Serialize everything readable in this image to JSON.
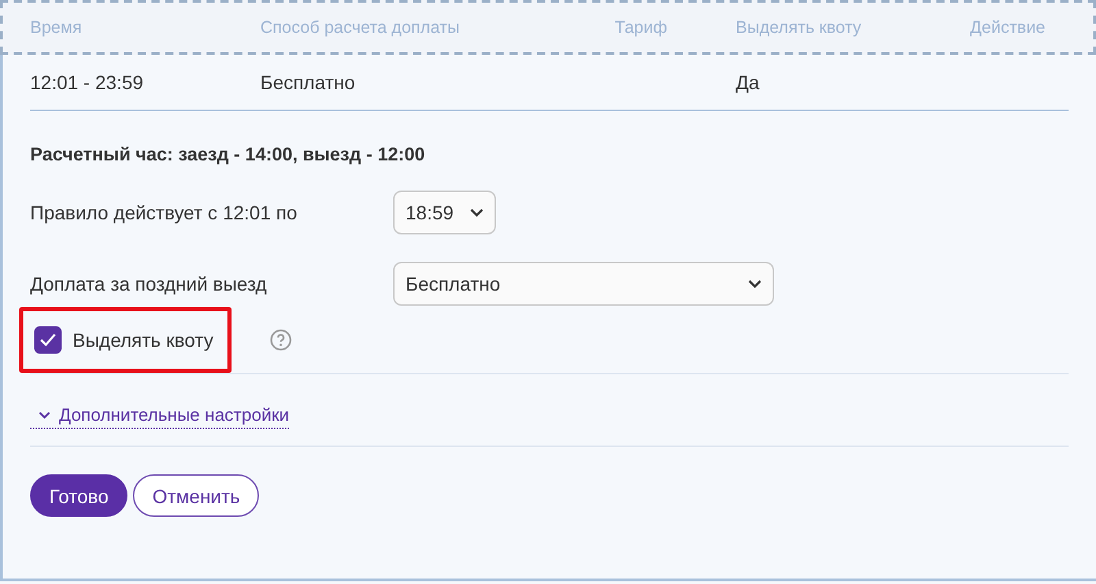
{
  "table": {
    "columns": [
      "Время",
      "Способ расчета доплаты",
      "Тариф",
      "Выделять квоту",
      "Действие"
    ],
    "rows": [
      {
        "cells": [
          "12:01 - 23:59",
          "Бесплатно",
          "",
          "Да",
          ""
        ]
      }
    ]
  },
  "form": {
    "heading": "Расчетный час: заезд - 14:00, выезд - 12:00",
    "fields": [
      {
        "label": "Правило действует с 12:01 по",
        "value": "18:59",
        "kind": "short"
      },
      {
        "label": "Доплата за поздний выезд",
        "value": "Бесплатно",
        "kind": "wide"
      }
    ],
    "quota": {
      "label": "Выделять квоту",
      "checked": true,
      "highlighted": true
    },
    "more": {
      "label": "Дополнительные настройки",
      "expanded": false
    },
    "buttons": [
      {
        "label": "Готово",
        "kind": "primary"
      },
      {
        "label": "Отменить",
        "kind": "secondary"
      }
    ]
  }
}
